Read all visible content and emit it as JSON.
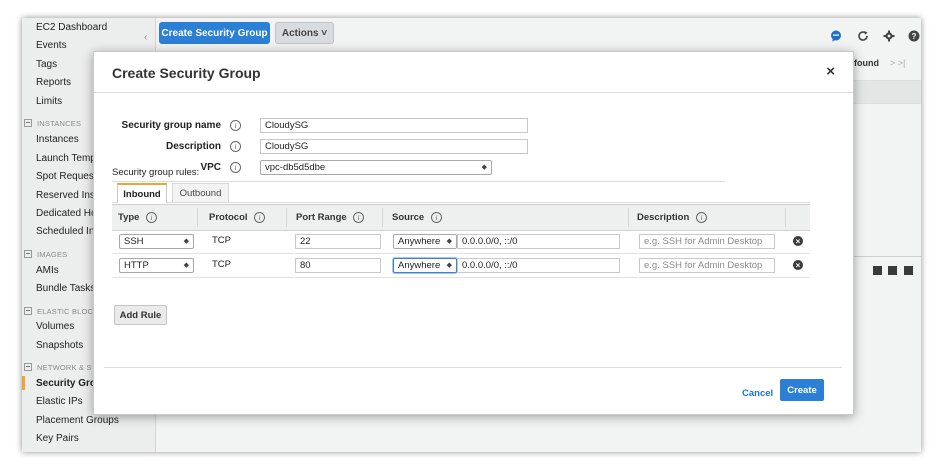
{
  "sidebar": {
    "items": [
      {
        "label": "EC2 Dashboard"
      },
      {
        "label": "Events"
      },
      {
        "label": "Tags"
      },
      {
        "label": "Reports"
      },
      {
        "label": "Limits"
      },
      {
        "section": "INSTANCES"
      },
      {
        "label": "Instances"
      },
      {
        "label": "Launch Temp"
      },
      {
        "label": "Spot Request"
      },
      {
        "label": "Reserved Inst"
      },
      {
        "label": "Dedicated Ho"
      },
      {
        "label": "Scheduled In"
      },
      {
        "section": "IMAGES"
      },
      {
        "label": "AMIs"
      },
      {
        "label": "Bundle Tasks"
      },
      {
        "section": "ELASTIC BLOC"
      },
      {
        "label": "Volumes"
      },
      {
        "label": "Snapshots"
      },
      {
        "section": "NETWORK & S"
      },
      {
        "label": "Security Gro",
        "active": true
      },
      {
        "label": "Elastic IPs"
      },
      {
        "label": "Placement Groups"
      },
      {
        "label": "Key Pairs"
      }
    ]
  },
  "toolbar": {
    "create_label": "Create Security Group",
    "actions_label": "Actions ˅",
    "collapse_glyph": "‹",
    "icons": [
      "chat-icon",
      "refresh-icon",
      "gear-icon",
      "help-icon"
    ]
  },
  "background": {
    "found_text": "found",
    "nav_text": "> >|"
  },
  "modal": {
    "title": "Create Security Group",
    "close_glyph": "×",
    "fields": {
      "name_label": "Security group name",
      "name_value": "CloudySG",
      "desc_label": "Description",
      "desc_value": "CloudySG",
      "vpc_label": "VPC",
      "vpc_value": "vpc-db5d5dbe"
    },
    "info_glyph": "i",
    "rules_label": "Security group rules:",
    "tabs": {
      "inbound": "Inbound",
      "outbound": "Outbound"
    },
    "columns": {
      "type": "Type",
      "protocol": "Protocol",
      "port_range": "Port Range",
      "source": "Source",
      "description": "Description"
    },
    "rows": [
      {
        "type": "SSH",
        "protocol": "TCP",
        "port": "22",
        "source": "Anywhere",
        "cidr": "0.0.0.0/0, ::/0",
        "desc_placeholder": "e.g. SSH for Admin Desktop"
      },
      {
        "type": "HTTP",
        "protocol": "TCP",
        "port": "80",
        "source": "Anywhere",
        "cidr": "0.0.0.0/0, ::/0",
        "desc_placeholder": "e.g. SSH for Admin Desktop"
      }
    ],
    "delete_glyph": "×",
    "add_rule_label": "Add Rule",
    "cancel_label": "Cancel",
    "create_label": "Create"
  }
}
